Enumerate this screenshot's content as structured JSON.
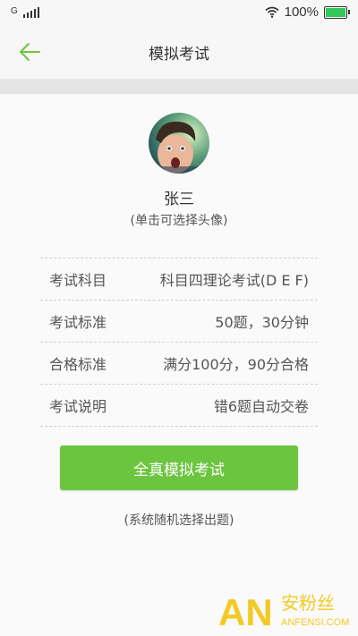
{
  "status_bar": {
    "carrier": "G",
    "battery_text": "100%",
    "battery_level": 1.0,
    "signal_icon": "signal-icon",
    "wifi_icon": "wifi-icon",
    "battery_icon": "battery-icon"
  },
  "nav": {
    "title": "模拟考试",
    "back_icon": "arrow-left-icon"
  },
  "profile": {
    "name": "张三",
    "avatar_hint": "(单击可选择头像)"
  },
  "exam_info": [
    {
      "label": "考试科目",
      "value": "科目四理论考试(D E F)"
    },
    {
      "label": "考试标准",
      "value": "50题，30分钟"
    },
    {
      "label": "合格标准",
      "value": "满分100分，90分合格"
    },
    {
      "label": "考试说明",
      "value": "错6题自动交卷"
    }
  ],
  "start_button": {
    "label": "全真模拟考试"
  },
  "footer_note": "(系统随机选择出题)",
  "watermark": {
    "logo": "AN",
    "site_cn": "安粉丝",
    "site_en": "ANFENSI.COM"
  },
  "colors": {
    "accent_green": "#6cc53f",
    "back_arrow": "#6cc53f",
    "nav_bg": "#f7f7f7",
    "content_bg": "#fafafa"
  }
}
